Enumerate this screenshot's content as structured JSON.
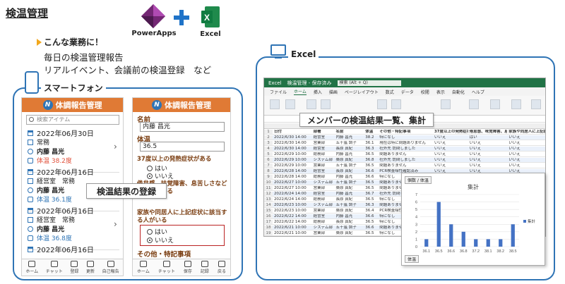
{
  "heading": "検温管理",
  "logos": {
    "powerapps": "PowerApps",
    "excel": "Excel"
  },
  "intro": {
    "headline": "こんな業務に！",
    "line1": "毎日の検温管理報告",
    "line2": "リアルイベント、会議前の検温登録　など"
  },
  "smartphone": {
    "section_label": "スマートフォン",
    "app_title": "体調報告管理",
    "search_placeholder": "検索アイテム",
    "records": [
      {
        "date": "2022年06月30日",
        "dept": "常務",
        "name": "内藤 昌光",
        "temp": "体温 38.2度"
      },
      {
        "date": "2022年06月16日",
        "dept": "経営室　常務",
        "name": "内藤 昌光",
        "temp": "体温 36.1度"
      },
      {
        "date": "2022年06月16日",
        "dept": "経営室　常務",
        "name": "内藤 昌光",
        "temp": "体温 36.8度"
      },
      {
        "date": "2022年06月16日",
        "dept": "",
        "name": "",
        "temp": ""
      }
    ],
    "nav_left": [
      "ホーム",
      "チャット",
      "登録",
      "更新",
      "自己報告"
    ],
    "form": {
      "name_label": "名前",
      "name_value": "内藤 昌光",
      "temp_label": "体温",
      "temp_value": "36.5",
      "q1": "37度以上の発熱症状がある",
      "q2": "倦怠感、味覚障害、息苦しさなどの症状がある",
      "q3": "家族や同居人に上記症状に該当する人がいる",
      "yes": "はい",
      "no": "いいえ",
      "other_label": "その他・特記事項"
    },
    "nav_right": [
      "ホーム",
      "チャット",
      "保存",
      "記録",
      "戻る"
    ],
    "overlay": "検温結果の登録"
  },
  "excel": {
    "section_label": "Excel",
    "titlebar_app": "Excel",
    "titlebar_file": "検温管理 - 保存済み",
    "search": "検索 (Alt + Q)",
    "menu": [
      "ファイル",
      "ホーム",
      "挿入",
      "描画",
      "ページレイアウト",
      "数式",
      "データ",
      "校閲",
      "表示",
      "自動化",
      "ヘルプ"
    ],
    "overlay": "メンバーの検温結果一覧、集計",
    "headers": [
      "日付",
      "部署",
      "名前",
      "体温",
      "その他・特記事項",
      "37度以上の発熱症状があるか",
      "倦怠感、味覚障害、息苦しさの症状があるか",
      "家族や同居人に上記症状に該当する人がいるか"
    ],
    "rows": [
      [
        "2022/6/30 14:00",
        "経営室",
        "内藤 昌光",
        "38.2",
        "特になし",
        "いいえ",
        "はい",
        "いいえ"
      ],
      [
        "2022/6/30 14:00",
        "営業部",
        "五十嵐 調子",
        "36.1",
        "現在は特に問題ありません",
        "いいえ",
        "いいえ",
        "いいえ"
      ],
      [
        "2022/6/30 14:00",
        "経営室",
        "長原 真紀",
        "36.3",
        "社外先 訪問しました",
        "いいえ",
        "いいえ",
        "いいえ"
      ],
      [
        "2022/6/29 10:00",
        "総務部",
        "内藤 昌光",
        "36.5",
        "問題ありません",
        "いいえ",
        "いいえ",
        "いいえ"
      ],
      [
        "2022/6/29 10:00",
        "システム部",
        "桑原 真紀",
        "36.8",
        "社外先 訪問しました",
        "いいえ",
        "いいえ",
        "いいえ"
      ],
      [
        "2022/6/29 10:00",
        "営業部",
        "五十嵐 調子",
        "36.5",
        "問題ありません",
        "いいえ",
        "いいえ",
        "いいえ"
      ],
      [
        "2022/6/28 14:00",
        "経営室",
        "長原 真紀",
        "36.6",
        "PCR検査陰性確認済み",
        "いいえ",
        "いいえ",
        "いいえ"
      ],
      [
        "2022/6/28 14:00",
        "総務部",
        "内藤 昌光",
        "36.6",
        "特になし",
        "いいえ",
        "いいえ",
        "いいえ"
      ],
      [
        "2022/6/27 10:00",
        "システム部",
        "五十嵐 調子",
        "36.5",
        "問題ありません",
        "いいえ",
        "いいえ",
        "いいえ"
      ],
      [
        "2022/6/27 10:00",
        "営業部",
        "桑原 真紀",
        "36.5",
        "問題ありません",
        "いいえ",
        "いいえ",
        "いいえ"
      ],
      [
        "2022/6/24 14:00",
        "経営室",
        "内藤 昌光",
        "36.7",
        "社外先 訪問しました",
        "いいえ",
        "いいえ",
        "いいえ"
      ],
      [
        "2022/6/24 14:00",
        "総務部",
        "長原 真紀",
        "36.5",
        "特になし",
        "いいえ",
        "いいえ",
        "いいえ"
      ],
      [
        "2022/6/23 10:00",
        "システム部",
        "五十嵐 調子",
        "36.3",
        "問題ありません",
        "いいえ",
        "いいえ",
        "いいえ"
      ],
      [
        "2022/6/23 10:00",
        "営業部",
        "桑原 真紀",
        "36.4",
        "PCR検査陰性確認済み",
        "いいえ",
        "いいえ",
        "いいえ"
      ],
      [
        "2022/6/22 14:00",
        "経営室",
        "内藤 昌光",
        "36.6",
        "特になし",
        "いいえ",
        "いいえ",
        "いいえ"
      ],
      [
        "2022/6/22 14:00",
        "総務部",
        "長原 真紀",
        "36.5",
        "特になし",
        "いいえ",
        "いいえ",
        "いいえ"
      ],
      [
        "2022/6/21 10:00",
        "システム部",
        "五十嵐 調子",
        "36.6",
        "問題ありません",
        "いいえ",
        "いいえ",
        "いいえ"
      ],
      [
        "2022/6/21 10:00",
        "営業部",
        "桑原 真紀",
        "36.5",
        "特になし",
        "いいえ",
        "いいえ",
        "いいえ"
      ],
      [
        "2022/6/20 14:00",
        "経営室",
        "内藤 昌光",
        "36.8",
        "特になし",
        "いいえ",
        "いいえ",
        "いいえ"
      ],
      [
        "2022/6/20 14:00",
        "総務部",
        "長原 真紀",
        "36.6",
        "特になし",
        "いいえ",
        "いいえ",
        "いいえ"
      ]
    ],
    "chart_tab": "個数 / 体温",
    "chart_footer": "体温"
  },
  "chart_data": {
    "type": "bar",
    "title": "集計",
    "categories": [
      "36.1",
      "36.5",
      "36.6",
      "36.8",
      "37.2",
      "38.1",
      "38.2",
      "38.5"
    ],
    "series": [
      {
        "name": "集計",
        "values": [
          1,
          6,
          3,
          2,
          1,
          1,
          1,
          3
        ]
      }
    ],
    "ylim": [
      0,
      7
    ],
    "yticks": [
      0,
      1,
      2,
      3,
      4,
      5,
      6,
      7
    ],
    "legend": "right",
    "color": "#4472c4"
  }
}
